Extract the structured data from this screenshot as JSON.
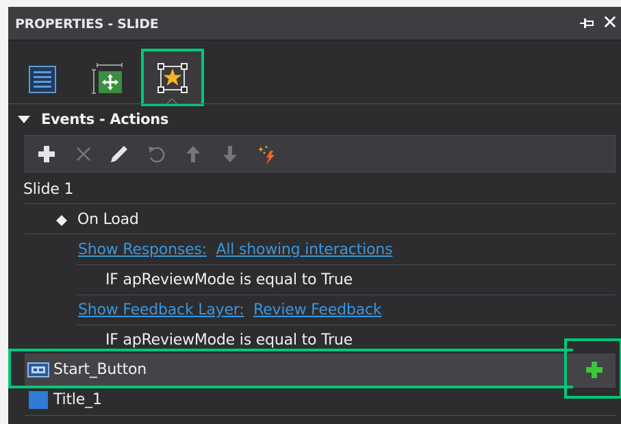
{
  "panel": {
    "title": "PROPERTIES - SLIDE"
  },
  "tabs": [
    {
      "name": "properties",
      "icon": "list-icon"
    },
    {
      "name": "layout",
      "icon": "move-layout-icon"
    },
    {
      "name": "events",
      "icon": "star-selection-icon",
      "selected": true
    }
  ],
  "section": {
    "title": "Events - Actions"
  },
  "toolbar": {
    "icons": [
      "plus-icon",
      "close-icon",
      "pencil-icon",
      "undo-icon",
      "arrow-up-icon",
      "arrow-down-icon",
      "sparkle-lightning-icon"
    ]
  },
  "tree": {
    "slide_label": "Slide 1",
    "event_label": "On Load",
    "action1": {
      "verb": "Show Responses:",
      "target": "All showing interactions",
      "condition": "IF apReviewMode is equal to True"
    },
    "action2": {
      "verb": "Show Feedback Layer:",
      "target": "Review Feedback",
      "condition": "IF apReviewMode is equal to True"
    },
    "objects": [
      {
        "label": "Start_Button",
        "icon": "button-object-icon"
      },
      {
        "label": "Title_1",
        "icon": "text-object-icon"
      }
    ]
  },
  "colors": {
    "highlight": "#00c878",
    "link": "#3a96dd",
    "add_green": "#3cc63c",
    "panel_bg": "#2d2d30"
  }
}
